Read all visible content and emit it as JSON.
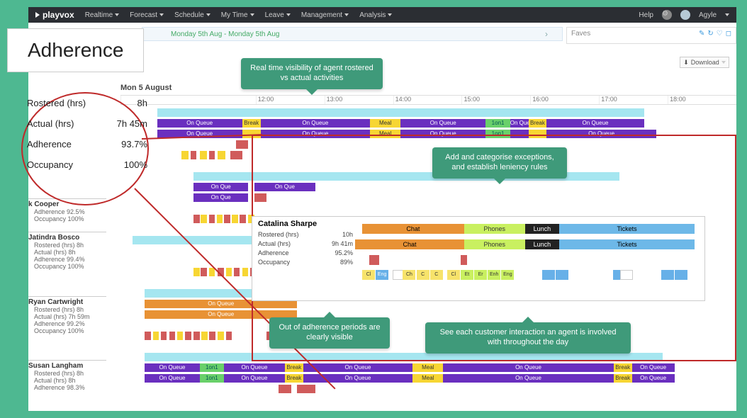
{
  "brand": "playvox",
  "nav": [
    "Realtime",
    "Forecast",
    "Schedule",
    "My Time",
    "Leave",
    "Management",
    "Analysis"
  ],
  "help": "Help",
  "user": "Agyle",
  "title": "Adherence",
  "crumb": "Monday 5th Aug - Monday 5th Aug",
  "faves": "Faves",
  "download": "Download",
  "date_label": "Mon 5 August",
  "time_ticks": [
    "12:00",
    "13:00",
    "14:00",
    "15:00",
    "16:00",
    "17:00",
    "18:00"
  ],
  "metrics": {
    "rostered_lbl": "Rostered (hrs)",
    "rostered_val": "8h",
    "actual_lbl": "Actual (hrs)",
    "actual_val": "7h 45m",
    "adherence_lbl": "Adherence",
    "adherence_val": "93.7%",
    "occupancy_lbl": "Occupancy",
    "occupancy_val": "100%"
  },
  "agents": [
    {
      "name": "k Cooper",
      "adherence": "92.5%",
      "occupancy": "100%"
    },
    {
      "name": "Jatindra Bosco",
      "rostered": "8h",
      "actual": "8h",
      "adherence": "99.4%",
      "occupancy": "100%"
    },
    {
      "name": "Ryan Cartwright",
      "rostered": "8h",
      "actual": "7h 59m",
      "adherence": "99.2%",
      "occupancy": "100%"
    },
    {
      "name": "Susan Langham",
      "rostered": "8h",
      "actual": "8h",
      "adherence": "98.3%"
    }
  ],
  "callouts": {
    "c1": "Real time visibility of agent rostered vs actual activities",
    "c2": "Add and categorise exceptions, and establish leniency rules",
    "c3": "Out of adherence periods are clearly visible",
    "c4": "See each customer interaction an agent is involved with throughout the day"
  },
  "seg_labels": {
    "onqueue": "On Queue",
    "break": "Break",
    "meal": "Meal",
    "oneon": "1on1",
    "chat": "Chat",
    "phones": "Phones",
    "lunch": "Lunch",
    "tickets": "Tickets",
    "onqs": "On Que"
  },
  "detail": {
    "name": "Catalina Sharpe",
    "rostered_lbl": "Rostered (hrs)",
    "rostered_val": "10h",
    "actual_lbl": "Actual (hrs)",
    "actual_val": "9h 41m",
    "adherence_lbl": "Adherence",
    "adherence_val": "95.2%",
    "occupancy_lbl": "Occupancy",
    "occupancy_val": "89%"
  },
  "chips": [
    "Cl",
    "Eng",
    "Ch",
    "C",
    "C",
    "Cl",
    "Et",
    "Er",
    "Enh",
    "Eng"
  ]
}
